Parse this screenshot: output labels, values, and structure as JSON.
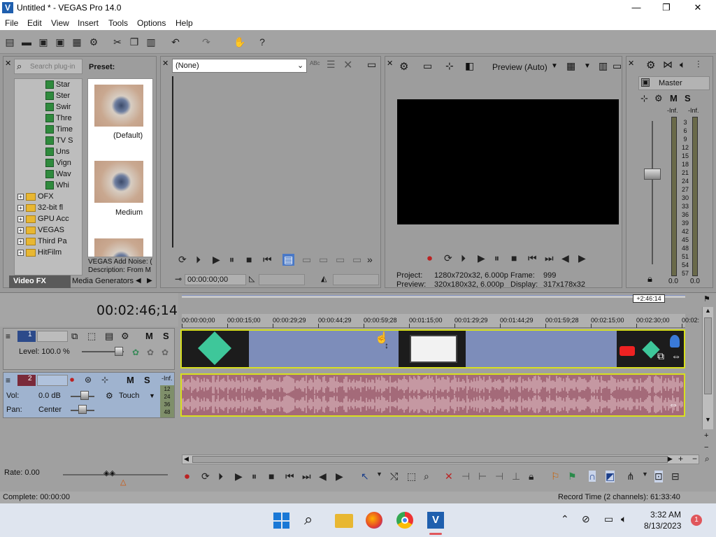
{
  "window": {
    "title": "Untitled * - VEGAS Pro 14.0",
    "app_icon": "vegas-logo-icon",
    "minimize": "—",
    "maximize": "❐",
    "close": "✕"
  },
  "menu": [
    "File",
    "Edit",
    "View",
    "Insert",
    "Tools",
    "Options",
    "Help"
  ],
  "plugin_panel": {
    "search_placeholder": "Search plug-in",
    "preset_label": "Preset:",
    "tree": [
      {
        "label": "Star",
        "type": "plugin"
      },
      {
        "label": "Ster",
        "type": "plugin"
      },
      {
        "label": "Swir",
        "type": "plugin"
      },
      {
        "label": "Thre",
        "type": "plugin"
      },
      {
        "label": "Time",
        "type": "plugin"
      },
      {
        "label": "TV S",
        "type": "plugin"
      },
      {
        "label": "Uns",
        "type": "plugin"
      },
      {
        "label": "Vign",
        "type": "plugin"
      },
      {
        "label": "Wav",
        "type": "plugin"
      },
      {
        "label": "Whi",
        "type": "plugin"
      },
      {
        "label": "OFX",
        "type": "folder"
      },
      {
        "label": "32-bit fl",
        "type": "folder"
      },
      {
        "label": "GPU Acc",
        "type": "folder"
      },
      {
        "label": "VEGAS",
        "type": "folder"
      },
      {
        "label": "Third Pa",
        "type": "folder"
      },
      {
        "label": "HitFilm",
        "type": "folder"
      }
    ],
    "presets": [
      "(Default)",
      "Medium"
    ],
    "description_title": "VEGAS Add Noise: (",
    "description": "Description: From M",
    "tabs": [
      "Video FX",
      "Media Generators"
    ]
  },
  "trimmer": {
    "dropdown_value": "(None)",
    "timecode": "00:00:00;00"
  },
  "preview": {
    "mode": "Preview (Auto)",
    "project_label": "Project:",
    "project_value": "1280x720x32, 6.000p",
    "preview_label": "Preview:",
    "preview_value": "320x180x32, 6.000p",
    "frame_label": "Frame:",
    "frame_value": "999",
    "display_label": "Display:",
    "display_value": "317x178x32"
  },
  "mixer": {
    "master_label": "Master",
    "inf_left": "-Inf.",
    "inf_right": "-Inf.",
    "bottom_left": "0.0",
    "bottom_right": "0.0",
    "scale": [
      "3",
      "6",
      "9",
      "12",
      "15",
      "18",
      "21",
      "24",
      "27",
      "30",
      "33",
      "36",
      "39",
      "42",
      "45",
      "48",
      "51",
      "54",
      "57"
    ]
  },
  "timeline": {
    "current_time": "00:02:46;14",
    "end_marker": "+2:46:14",
    "ruler": [
      "00:00:00;00",
      "00:00:15;00",
      "00:00:29;29",
      "00:00:44;29",
      "00:00:59;28",
      "00:01:15;00",
      "00:01:29;29",
      "00:01:44;29",
      "00:01:59;28",
      "00:02:15;00",
      "00:02:30;00",
      "00:02:"
    ],
    "video_track": {
      "number": "1",
      "level": "Level: 100.0 %",
      "m": "M",
      "s": "S"
    },
    "audio_track": {
      "number": "2",
      "vol_label": "Vol:",
      "vol_value": "0.0 dB",
      "pan_label": "Pan:",
      "pan_value": "Center",
      "touch": "Touch",
      "m": "M",
      "s": "S",
      "inf": "-Inf.",
      "meter": [
        "12",
        "24",
        "36",
        "48"
      ]
    },
    "rate": "Rate: 0.00"
  },
  "status": {
    "complete": "Complete: 00:00:00",
    "record_time": "Record Time (2 channels): 61:33:40"
  },
  "taskbar": {
    "time": "3:32 AM",
    "date": "8/13/2023",
    "notification_count": "1"
  },
  "colors": {
    "video_clip": "#7d8dba",
    "audio_clip": "#a46a79",
    "clip_border": "#d8e01e",
    "accent": "#1f5fae"
  }
}
